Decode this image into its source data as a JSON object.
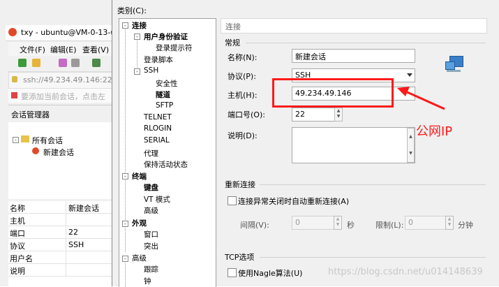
{
  "bg_window": {
    "title": "txy - ubuntu@VM-0-13-u",
    "menu": [
      "文件(F)",
      "编辑(E)",
      "查看(V)"
    ],
    "address": "ssh://49.234.49.146:22",
    "hint": "要添加当前会话，点击左",
    "session_manager": "会话管理器",
    "tree": {
      "root": "所有会话",
      "child": "新建会话"
    },
    "props": [
      {
        "key": "名称",
        "value": "新建会话"
      },
      {
        "key": "主机",
        "value": ""
      },
      {
        "key": "端口",
        "value": "22"
      },
      {
        "key": "协议",
        "value": "SSH"
      },
      {
        "key": "用户名",
        "value": ""
      },
      {
        "key": "说明",
        "value": ""
      }
    ]
  },
  "dialog": {
    "category_label": "类别(C):",
    "tree": [
      {
        "label": "连接",
        "level": 0,
        "bold": true
      },
      {
        "label": "用户身份验证",
        "level": 1,
        "bold": true
      },
      {
        "label": "登录提示符",
        "level": 2,
        "bold": false
      },
      {
        "label": "登录脚本",
        "level": 1,
        "bold": false
      },
      {
        "label": "SSH",
        "level": 1,
        "bold": false
      },
      {
        "label": "安全性",
        "level": 2,
        "bold": false
      },
      {
        "label": "隧道",
        "level": 2,
        "bold": true
      },
      {
        "label": "SFTP",
        "level": 2,
        "bold": false
      },
      {
        "label": "TELNET",
        "level": 1,
        "bold": false
      },
      {
        "label": "RLOGIN",
        "level": 1,
        "bold": false
      },
      {
        "label": "SERIAL",
        "level": 1,
        "bold": false
      },
      {
        "label": "代理",
        "level": 1,
        "bold": false
      },
      {
        "label": "保持活动状态",
        "level": 1,
        "bold": false
      },
      {
        "label": "终端",
        "level": 0,
        "bold": true
      },
      {
        "label": "键盘",
        "level": 1,
        "bold": true
      },
      {
        "label": "VT 模式",
        "level": 1,
        "bold": false
      },
      {
        "label": "高级",
        "level": 1,
        "bold": false
      },
      {
        "label": "外观",
        "level": 0,
        "bold": true
      },
      {
        "label": "窗口",
        "level": 1,
        "bold": false
      },
      {
        "label": "突出",
        "level": 1,
        "bold": false
      },
      {
        "label": "高级",
        "level": 0,
        "bold": false
      },
      {
        "label": "跟踪",
        "level": 1,
        "bold": false
      },
      {
        "label": "钟",
        "level": 1,
        "bold": false
      }
    ],
    "section_header": "连接",
    "general": {
      "title": "常规",
      "name_label": "名称(N):",
      "name_value": "新建会话",
      "protocol_label": "协议(P):",
      "protocol_value": "SSH",
      "host_label": "主机(H):",
      "host_value": "49.234.49.146",
      "port_label": "端口号(O):",
      "port_value": "22",
      "desc_label": "说明(D):",
      "desc_value": ""
    },
    "reconnect": {
      "title": "重新连接",
      "checkbox_label": "连接异常关闭时自动重新连接(A)",
      "interval_label": "间隔(V):",
      "interval_value": "0",
      "sec_label": "秒",
      "limit_label": "限制(L):",
      "limit_value": "0",
      "min_label": "分钟"
    },
    "tcp": {
      "title": "TCP选项",
      "nagle_label": "使用Nagle算法(U)"
    }
  },
  "annotation": {
    "text": "公网IP",
    "color": "#ff1a1a"
  },
  "watermark": "https://blog.csdn.net/u014148639"
}
